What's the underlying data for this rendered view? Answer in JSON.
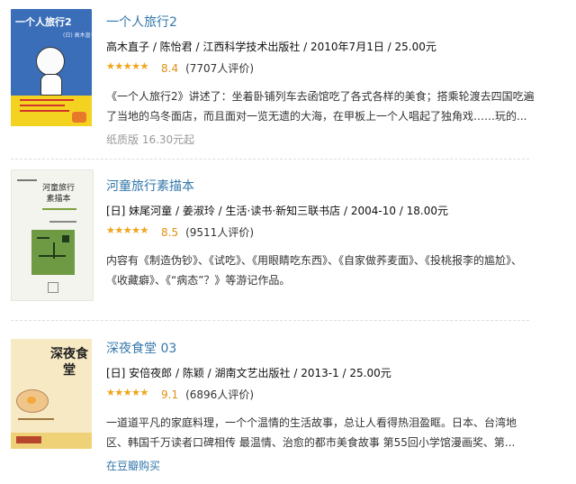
{
  "books": [
    {
      "title": "一个人旅行2",
      "pub": "高木直子 / 陈怡君 / 江西科学技术出版社 / 2010年7月1日 / 25.00元",
      "rating": {
        "score": "8.4",
        "votes": "(7707人评价)",
        "stars": 4.5
      },
      "desc": "《一个人旅行2》讲述了：坐着卧铺列车去函馆吃了各式各样的美食；搭乘轮渡去四国吃遍了当地的乌冬面店，而且面对一览无遗的大海，在甲板上一个人唱起了独角戏……玩的...",
      "extra": "纸质版 16.30元起",
      "cover": {
        "title": "一个人旅行2",
        "author": "(日) 高木直子",
        "color": "#3a6eb8"
      }
    },
    {
      "title": "河童旅行素描本",
      "pub": "[日] 妹尾河童 / 姜淑玲 / 生活·读书·新知三联书店 / 2004-10 / 18.00元",
      "rating": {
        "score": "8.5",
        "votes": "(9511人评价)",
        "stars": 4.5
      },
      "desc": "内容有《制造伪钞》、《试吃》、《用眼睛吃东西》、《自家做荞麦面》、《投桃报李的尴尬》、《收藏癖》、《“病态”？》等游记作品。",
      "extra": "",
      "cover": {
        "title": "河童旅行素描本",
        "color": "#f4f4ee"
      }
    },
    {
      "title": "深夜食堂 03",
      "pub": "[日] 安倍夜郎 / 陈颖 / 湖南文艺出版社 / 2013-1 / 25.00元",
      "rating": {
        "score": "9.1",
        "votes": "(6896人评价)",
        "stars": 4.5
      },
      "desc": "一道道平凡的家庭料理，一个个温情的生活故事，总让人看得热泪盈眶。日本、台湾地区、韩国千万读者口碑相传 最温情、治愈的都市美食故事 第55回小学馆漫画奖、第...",
      "extra": "在豆瓣购买",
      "cover": {
        "title": "深夜食堂",
        "color": "#efd278"
      }
    }
  ]
}
